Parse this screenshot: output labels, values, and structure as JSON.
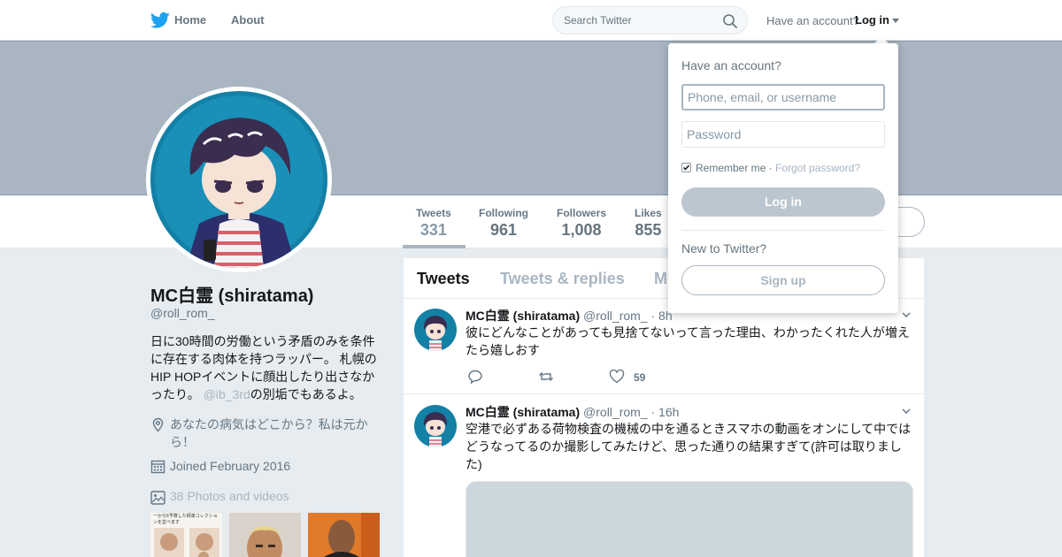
{
  "colors": {
    "brand": "#1da1f2",
    "banner": "#a9b6c2",
    "muted": "#657786",
    "avatar_bg": "#1380a6"
  },
  "nav": {
    "home_label": "Home",
    "about_label": "About",
    "search_placeholder": "Search Twitter",
    "have_account": "Have an account?",
    "login_label": "Log in",
    "icons": {
      "logo": "twitter-bird-icon",
      "search": "magnifier-icon",
      "caret": "caret-down-icon"
    }
  },
  "stats": [
    {
      "label": "Tweets",
      "value": "331"
    },
    {
      "label": "Following",
      "value": "961"
    },
    {
      "label": "Followers",
      "value": "1,008"
    },
    {
      "label": "Likes",
      "value": "855"
    }
  ],
  "profile": {
    "name": "MC白霊 (shiratama)",
    "handle": "@roll_rom_",
    "bio_text": "日に30時間の労働という矛盾のみを条件に存在する肉体を持つラッパー。 札幌のHIP HOPイベントに顔出したり出さなかったり。",
    "bio_mention": "@ib_3rd",
    "bio_suffix": "の別垢でもあるよ。",
    "location": "あなたの病気はどこから？私は元から！",
    "joined": "Joined February 2016",
    "photos_label": "38 Photos and videos",
    "thumb1_caption": "一から6予算した師弟コレクションを並べます"
  },
  "timeline": {
    "tabs": [
      "Tweets",
      "Tweets & replies",
      "M"
    ],
    "tweets": [
      {
        "name": "MC白霊 (shiratama)",
        "handle": "@roll_rom_",
        "time": "· 8h",
        "text": "彼にどんなことがあっても見捨てないって言った理由、わかったくれた人が増えたら嬉しおす",
        "likes": "59"
      },
      {
        "name": "MC白霊 (shiratama)",
        "handle": "@roll_rom_",
        "time": "· 16h",
        "text": "空港で必ずある荷物検査の機械の中を通るときスマホの動画をオンにして中ではどうなってるのか撮影してみたけど、思った通りの結果すぎて(許可は取りました)"
      }
    ]
  },
  "login_dropdown": {
    "title": "Have an account?",
    "username_placeholder": "Phone, email, or username",
    "password_placeholder": "Password",
    "remember_label": "Remember me",
    "separator": " · ",
    "forgot_label": "Forgot password?",
    "login_button": "Log in",
    "new_label": "New to Twitter?",
    "signup_button": "Sign up"
  }
}
